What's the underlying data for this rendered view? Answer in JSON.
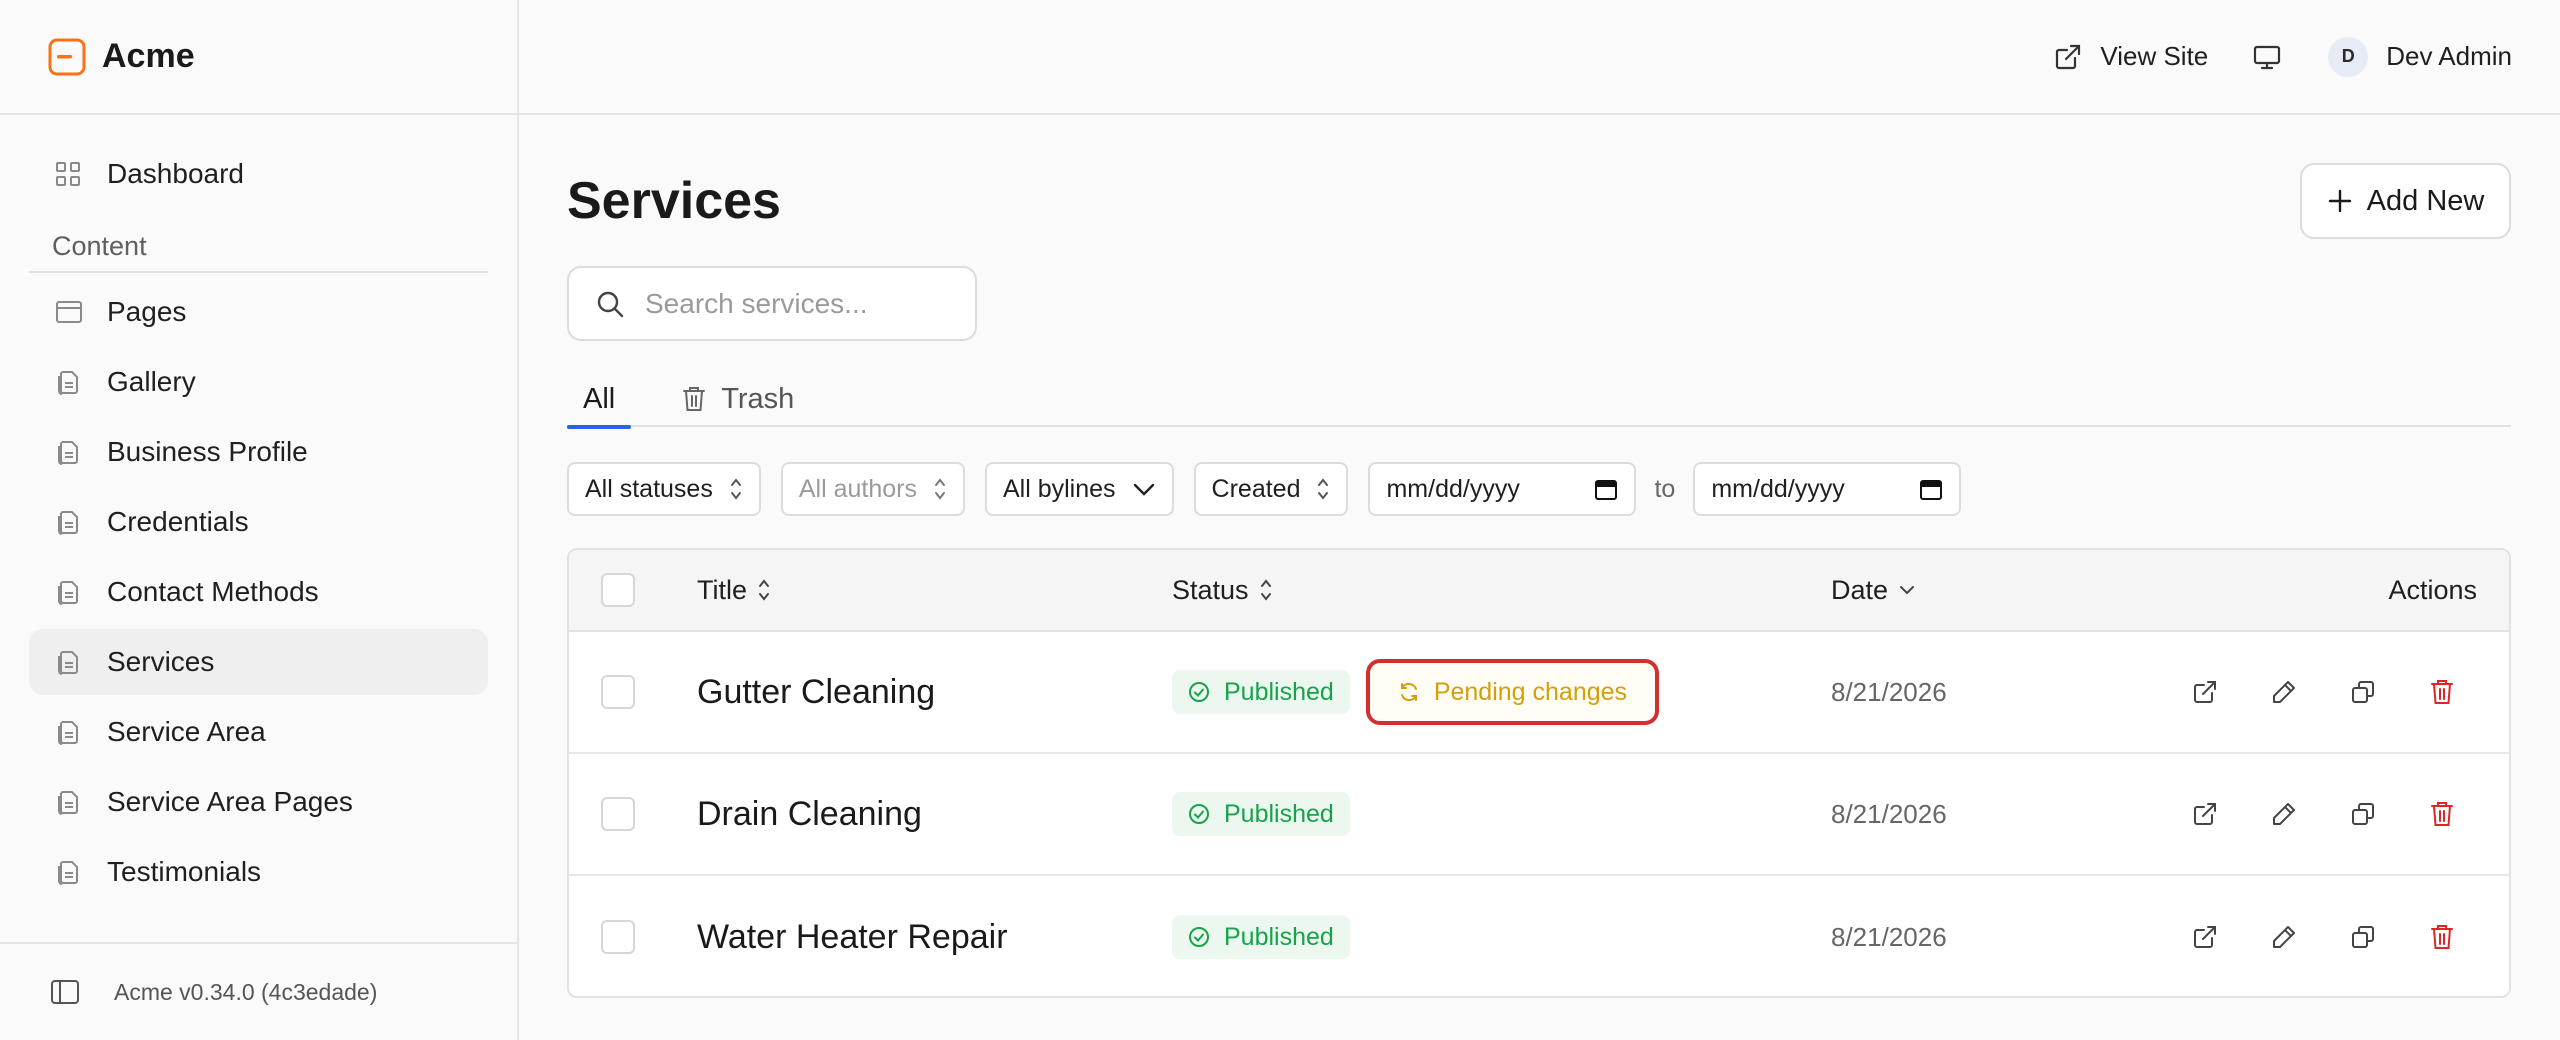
{
  "brand": {
    "name": "Acme",
    "accent": "#f97316"
  },
  "sidebar": {
    "top_item": {
      "label": "Dashboard",
      "icon": "grid-icon"
    },
    "section_label": "Content",
    "items": [
      {
        "label": "Pages",
        "icon": "browser-icon"
      },
      {
        "label": "Gallery",
        "icon": "document-stack-icon"
      },
      {
        "label": "Business Profile",
        "icon": "document-stack-icon"
      },
      {
        "label": "Credentials",
        "icon": "document-stack-icon"
      },
      {
        "label": "Contact Methods",
        "icon": "document-stack-icon"
      },
      {
        "label": "Services",
        "icon": "document-stack-icon",
        "active": true
      },
      {
        "label": "Service Area",
        "icon": "document-stack-icon"
      },
      {
        "label": "Service Area Pages",
        "icon": "document-stack-icon"
      },
      {
        "label": "Testimonials",
        "icon": "document-stack-icon"
      }
    ],
    "footer_version": "Acme v0.34.0 (4c3edade)"
  },
  "topbar": {
    "view_site_label": "View Site",
    "user": {
      "initial": "D",
      "name": "Dev Admin"
    }
  },
  "main": {
    "title": "Services",
    "add_new_label": "Add New",
    "search": {
      "placeholder": "Search services...",
      "value": ""
    },
    "tabs": [
      {
        "label": "All",
        "active": true
      },
      {
        "label": "Trash",
        "active": false
      }
    ],
    "filters": {
      "status": "All statuses",
      "authors": "All authors",
      "bylines": "All bylines",
      "sort": "Created",
      "date_from": "mm/dd/yyyy",
      "to_label": "to",
      "date_to": "mm/dd/yyyy"
    }
  },
  "table": {
    "headers": {
      "title": "Title",
      "status": "Status",
      "date": "Date",
      "actions": "Actions"
    },
    "rows": [
      {
        "title": "Gutter Cleaning",
        "status": "Published",
        "pending": "Pending changes",
        "date": "8/21/2026"
      },
      {
        "title": "Drain Cleaning",
        "status": "Published",
        "date": "8/21/2026"
      },
      {
        "title": "Water Heater Repair",
        "status": "Published",
        "date": "8/21/2026"
      }
    ]
  },
  "colors": {
    "published": "#16a34a",
    "pending": "#d4a00a",
    "highlight_border": "#d32f2f",
    "delete": "#dc2626",
    "tab_indicator": "#2563eb"
  }
}
